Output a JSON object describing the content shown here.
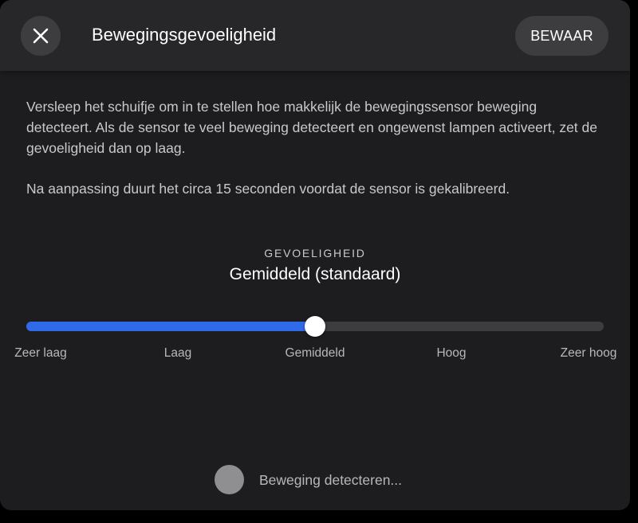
{
  "header": {
    "title": "Bewegingsgevoeligheid",
    "close_icon": "close-icon",
    "save_label": "BEWAAR"
  },
  "description": {
    "paragraph1": "Versleep het schuifje om in te stellen hoe makkelijk de bewegingssensor beweging detecteert. Als de sensor te veel beweging detecteert en ongewenst lampen activeert, zet de gevoeligheid dan op laag.",
    "paragraph2": "Na aanpassing duurt het circa 15 seconden voordat de sensor is gekalibreerd."
  },
  "sensitivity": {
    "label": "GEVOELIGHEID",
    "value": "Gemiddeld (standaard)",
    "slider": {
      "selected_index": 2,
      "fill_fraction": 0.5,
      "fill_color": "#2f6be8",
      "track_color": "#3d3d40",
      "levels": [
        "Zeer laag",
        "Laag",
        "Gemiddeld",
        "Hoog",
        "Zeer hoog"
      ]
    }
  },
  "status": {
    "text": "Beweging detecteren...",
    "dot_color": "#8f8f92"
  }
}
